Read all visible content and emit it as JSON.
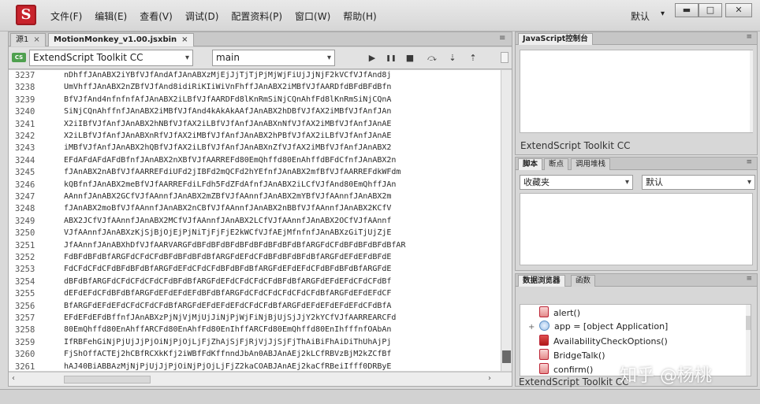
{
  "app": {
    "logo_glyph": "S",
    "menu": [
      "文件(F)",
      "编辑(E)",
      "查看(V)",
      "调试(D)",
      "配置资料(P)",
      "窗口(W)",
      "帮助(H)"
    ],
    "workspace_label": "默认",
    "window_buttons": [
      "▬",
      "□",
      "✕"
    ]
  },
  "editor": {
    "tabs": [
      {
        "label": "源1",
        "close": "×"
      },
      {
        "label": "MotionMonkey_v1.00.jsxbin",
        "close": "×"
      }
    ],
    "target_icon": "CS",
    "target_select": "ExtendScript Toolkit CC",
    "engine_select": "main",
    "debug_buttons": [
      "▶",
      "❚❚",
      "■",
      "⤼",
      "⇣",
      "⇡"
    ],
    "lines": [
      {
        "n": "3237",
        "text": "nDhffJAnABX2iYBfVJfAndAfJAnABXzMjEjJjTjTjPjMjWjFiUjJjNjF2kVCfVJfAnd8j"
      },
      {
        "n": "3238",
        "text": "UmVhffJAnABX2nZBfVJfAnd8idiRiKIiWiVnFhffJAnABX2iMBfVJfAARDfdBFdBFdBfn"
      },
      {
        "n": "3239",
        "text": "BfVJfAnd4nfnfnfAfJAnABX2iLBfVJfAARDFd8lKnRmSiNjCQnAhfFd8lKnRmSiNjCQnA"
      },
      {
        "n": "3240",
        "text": "SiNjCQnAhffnfJAnABX2iMBfVJfAnd4kAkAkAAfJAnABX2hDBfVJfAX2iMBfVJfAnfJAn"
      },
      {
        "n": "3241",
        "text": "X2iIBfVJfAnfJAnABX2hNBfVJfAX2iLBfVJfAnfJAnABXnNfVJfAX2iMBfVJfAnfJAnAE"
      },
      {
        "n": "3242",
        "text": "X2iLBfVJfAnfJAnABXnRfVJfAX2iMBfVJfAnfJAnABX2hPBfVJfAX2iLBfVJfAnfJAnAE"
      },
      {
        "n": "3243",
        "text": "iMBfVJfAnfJAnABX2hQBfVJfAX2iLBfVJfAnfJAnABXnZfVJfAX2iMBfVJfAnfJAnABX2"
      },
      {
        "n": "3244",
        "text": "EFdAFdAFdAFdBfnfJAnABX2nXBfVJfAARREFd80EmQhffd80EnAhffdBFdCfnfJAnABX2n"
      },
      {
        "n": "3245",
        "text": "fJAnABX2nABfVJfAARREFdiUFd2jIBFd2mQCFd2hYEfnfJAnABX2mfBfVJfAARREFdkWFdm"
      },
      {
        "n": "3246",
        "text": "kQBfnfJAnABX2meBfVJfAARREFdiLFdh5FdZFdAfnfJAnABX2iLCfVJfAnd80EmQhffJAn"
      },
      {
        "n": "3247",
        "text": "AAnnfJAnABX2GCfVJfAAnnfJAnABX2mZBfVJfAAnnfJAnABX2mYBfVJfAAnnfJAnABX2m"
      },
      {
        "n": "3248",
        "text": "fJAnABX2moBfVJfAAnnfJAnABX2nCBfVJfAAnnfJAnABX2nBBfVJfAAnnfJAnABX2KCfV"
      },
      {
        "n": "3249",
        "text": "ABX2JCfVJfAAnnfJAnABX2MCfVJfAAnnfJAnABX2LCfVJfAAnnfJAnABX2OCfVJfAAnnf"
      },
      {
        "n": "3250",
        "text": "VJfAAnnfJAnABXzKjSjBjOjEjPjNiTjFjFjE2kWCfVJfAEjMfnfnfJAnABXzGiTjUjZjE"
      },
      {
        "n": "3251",
        "text": "JfAAnnfJAnABXhDfVJfAARVARGFdBFdBFdBFdBFdBFdBFdBFdBfARGFdCFdBFdBFdBFdBfAR"
      },
      {
        "n": "3252",
        "text": "FdBFdBFdBfARGFdCFdCFdBFdBFdBFdBfARGFdEFdCFdBFdBFdBFdBfARGFdEFdEFdBFdE"
      },
      {
        "n": "3253",
        "text": "FdCFdCFdCFdBFdBFdBfARGFdEFdCFdCFdBFdBFdBfARGFdEFdEFdCFdBFdBFdBfARGFdE"
      },
      {
        "n": "3254",
        "text": "dBFdBfARGFdCFdCFdCFdCFdBFdBfARGFdEFdCFdCFdCFdBFdBfARGFdEFdEFdCFdCFdBf"
      },
      {
        "n": "3255",
        "text": "dEFdEFdCFdBFdBfARGFdEFdEFdEFdBFdBfARGFdCFdCFdCFdCFdCFdBfARGFdEFdEFdCF"
      },
      {
        "n": "3256",
        "text": "BfARGFdEFdEFdCFdCFdCFdBfARGFdEFdEFdEFdCFdCFdBfARGFdEFdEFdEFdEFdCFdBfA"
      },
      {
        "n": "3257",
        "text": "EFdEFdEFdBffnfJAnABXzPjNjVjMjUjJiNjPjWjFiNjBjUjSjJjY2kYCfVJfAARREARCFd"
      },
      {
        "n": "3258",
        "text": "80EmQhffd80EnAhffARCFd80EnAhfFd80EnIhffARCFd80EmQhffd80EnIhfffnfOAbAn"
      },
      {
        "n": "3259",
        "text": "IfRBFehGiNjPjUjJjPjOiNjPjOjLjFjZhAjSjFjRjVjJjSjFjThAiBiFhAiDiThUhAjPj"
      },
      {
        "n": "3260",
        "text": "FjShOffACTEj2hCBfRCXkKfj2iWBfFdKffnndJbAn0ABJAnAEj2kLCfRBVzBjM2kZCfBf"
      },
      {
        "n": "3261",
        "text": "hAJ40BiABBAzMjNjPjUjJjPjOiNjPjOjLjFjZ2kaCOABJAnAEj2kaCfRBeiIfff0DRByE"
      }
    ]
  },
  "console_panel": {
    "tab": "JavaScript控制台",
    "target": "ExtendScript Toolkit CC"
  },
  "callstack_panel": {
    "tabs": [
      "脚本",
      "断点",
      "调用堆栈"
    ],
    "select_left": "收藏夹",
    "select_right": "默认"
  },
  "browser_panel": {
    "tabs": [
      "数据浏览器",
      "函数"
    ],
    "items": [
      {
        "label": "alert()",
        "expand": "",
        "icon": "method"
      },
      {
        "label": "app = [object Application]",
        "expand": "+",
        "icon": "object"
      },
      {
        "label": "AvailabilityCheckOptions()",
        "expand": "",
        "icon": "method-strong"
      },
      {
        "label": "BridgeTalk()",
        "expand": "",
        "icon": "method"
      },
      {
        "label": "confirm()",
        "expand": "",
        "icon": "method"
      }
    ],
    "target": "ExtendScript Toolkit CC"
  },
  "watermark": "知乎 @杨桃"
}
